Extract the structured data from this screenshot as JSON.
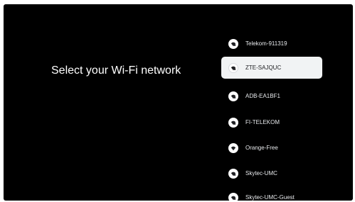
{
  "page": {
    "title": "Select your Wi-Fi network"
  },
  "colors": {
    "background": "#000000",
    "selected_background": "#f1f3f4",
    "text_light": "#e8eaed",
    "text_dark": "#202124"
  },
  "networks": [
    {
      "ssid": "Telekom-911319",
      "secured": true,
      "selected": false,
      "icon": "wifi-lock-icon"
    },
    {
      "ssid": "ZTE-SAJQUC",
      "secured": true,
      "selected": true,
      "icon": "wifi-lock-icon"
    },
    {
      "ssid": "ADB-EA1BF1",
      "secured": true,
      "selected": false,
      "icon": "wifi-lock-icon"
    },
    {
      "ssid": "FI-TELEKOM",
      "secured": true,
      "selected": false,
      "icon": "wifi-lock-icon"
    },
    {
      "ssid": "Orange-Free",
      "secured": false,
      "selected": false,
      "icon": "wifi-icon"
    },
    {
      "ssid": "Skytec-UMC",
      "secured": true,
      "selected": false,
      "icon": "wifi-lock-icon"
    },
    {
      "ssid": "Skytec-UMC-Guest",
      "secured": true,
      "selected": false,
      "icon": "wifi-lock-icon"
    }
  ]
}
